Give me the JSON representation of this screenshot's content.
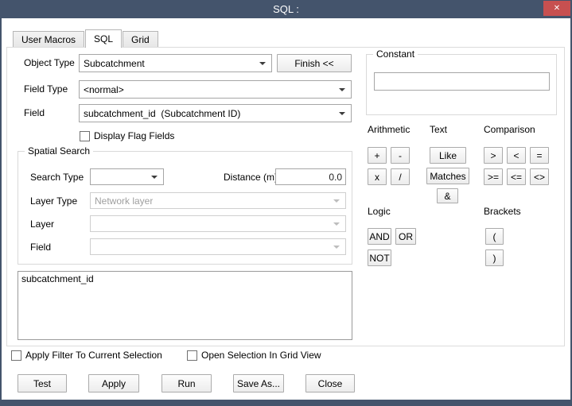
{
  "window": {
    "title": "SQL :"
  },
  "icons": {
    "close": "✕"
  },
  "colors": {
    "titlebar_color": "#44546c",
    "close_color": "#c75050"
  },
  "tabs": [
    {
      "label": "User Macros",
      "active": false
    },
    {
      "label": "SQL",
      "active": true
    },
    {
      "label": "Grid",
      "active": false
    }
  ],
  "form": {
    "object_type_label": "Object Type",
    "object_type_value": "Subcatchment",
    "finish_button_label": "Finish <<",
    "field_type_label": "Field Type",
    "field_type_value": "<normal>",
    "field_label": "Field",
    "field_value": "subcatchment_id  (Subcatchment ID)",
    "display_flag_fields_label": "Display Flag Fields",
    "display_flag_fields_checked": false
  },
  "spatial_search": {
    "title": "Spatial Search",
    "search_type_label": "Search Type",
    "search_type_value": "",
    "distance_label": "Distance (m)",
    "distance_value": "0.0",
    "layer_type_label": "Layer Type",
    "layer_type_value": "Network layer",
    "layer_label": "Layer",
    "layer_value": "",
    "field_label": "Field",
    "field_value": ""
  },
  "constant": {
    "title": "Constant",
    "value": ""
  },
  "operators": {
    "arithmetic_label": "Arithmetic",
    "arithmetic": [
      "+",
      "-",
      "x",
      "/"
    ],
    "text_label": "Text",
    "text": [
      "Like",
      "Matches",
      "&"
    ],
    "comparison_label": "Comparison",
    "comparison": [
      ">",
      "<",
      "=",
      ">=",
      "<=",
      "<>"
    ],
    "logic_label": "Logic",
    "logic": [
      "AND",
      "OR",
      "NOT"
    ],
    "brackets_label": "Brackets",
    "brackets": [
      "(",
      ")"
    ]
  },
  "sql_editor": {
    "text": "subcatchment_id"
  },
  "options": {
    "apply_filter_label": "Apply Filter To Current Selection",
    "apply_filter_checked": false,
    "grid_view_label": "Open Selection In Grid View",
    "grid_view_checked": false
  },
  "actions": [
    "Test",
    "Apply",
    "Run",
    "Save As...",
    "Close"
  ]
}
